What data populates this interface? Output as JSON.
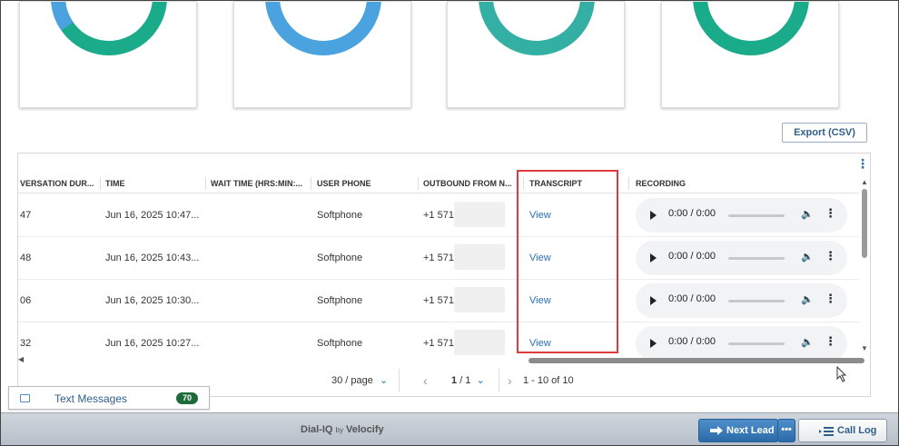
{
  "donuts": [
    {
      "name": "donut-card-1",
      "color_main": "#1aab8a",
      "color_secondary": "#4aa3df"
    },
    {
      "name": "donut-card-2",
      "color_main": "#4aa3df",
      "color_secondary": "#4aa3df"
    },
    {
      "name": "donut-card-3",
      "color_main": "#33b0a3",
      "color_secondary": "#33b0a3"
    },
    {
      "name": "donut-card-4",
      "color_main": "#1aab8a",
      "color_secondary": "#1aab8a"
    }
  ],
  "export_label": "Export (CSV)",
  "table": {
    "headers": {
      "conversation_duration": "VERSATION DUR...",
      "time": "TIME",
      "wait_time": "WAIT TIME (HRS:MIN:...",
      "user_phone": "USER PHONE",
      "outbound_from": "OUTBOUND FROM N...",
      "transcript": "TRANSCRIPT",
      "recording": "RECORDING"
    },
    "rows": [
      {
        "duration": "47",
        "time": "Jun 16, 2025 10:47...",
        "wait": "",
        "user_phone": "Softphone",
        "outbound": "+1 571",
        "transcript": "View",
        "recording_time": "0:00 / 0:00"
      },
      {
        "duration": "48",
        "time": "Jun 16, 2025 10:43...",
        "wait": "",
        "user_phone": "Softphone",
        "outbound": "+1 571",
        "transcript": "View",
        "recording_time": "0:00 / 0:00"
      },
      {
        "duration": "06",
        "time": "Jun 16, 2025 10:30...",
        "wait": "",
        "user_phone": "Softphone",
        "outbound": "+1 571",
        "transcript": "View",
        "recording_time": "0:00 / 0:00"
      },
      {
        "duration": "32",
        "time": "Jun 16, 2025 10:27...",
        "wait": "",
        "user_phone": "Softphone",
        "outbound": "+1 571",
        "transcript": "View",
        "recording_time": "0:00 / 0:00"
      }
    ]
  },
  "pagination": {
    "page_size": "30 / page",
    "current_page": "1",
    "total_pages": "/ 1",
    "range": "1 - 10 of 10"
  },
  "text_messages": {
    "label": "Text Messages",
    "count": "70"
  },
  "footer": {
    "brand_name": "Dial-IQ",
    "brand_by": "by",
    "brand_company": "Velocify",
    "next_lead": "Next Lead",
    "more": "•••",
    "call_log": "Call Log"
  },
  "colors": {
    "accent": "#2a6fb8",
    "highlight_box": "#e0393e",
    "badge": "#1e6b3a"
  }
}
